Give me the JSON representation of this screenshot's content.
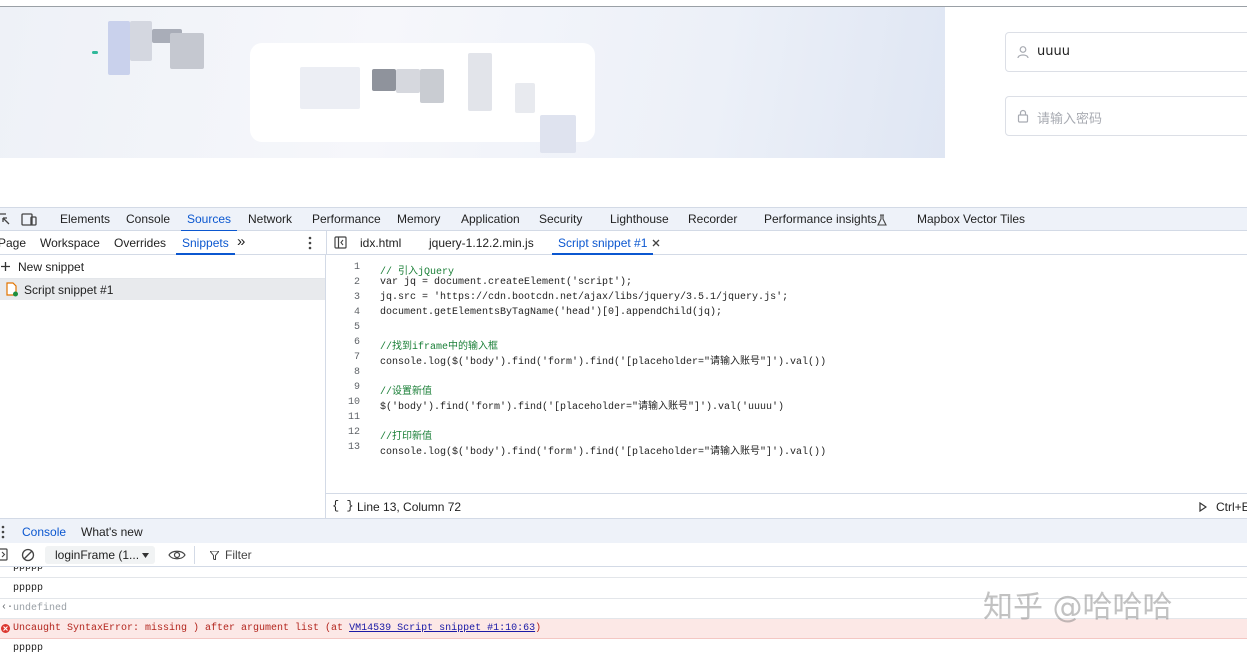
{
  "preview": {
    "username_value": "uuuu",
    "password_placeholder": "请输入密码"
  },
  "devtools": {
    "main_tabs": [
      "Elements",
      "Console",
      "Sources",
      "Network",
      "Performance",
      "Memory",
      "Application",
      "Security",
      "Lighthouse",
      "Recorder",
      "Performance insights",
      "Mapbox Vector Tiles"
    ],
    "active_main_tab": "Sources",
    "nav_tabs": [
      "Page",
      "Workspace",
      "Overrides",
      "Snippets"
    ],
    "active_nav_tab": "Snippets",
    "more_tabs_glyph": "»",
    "file_tabs": [
      "idx.html",
      "jquery-1.12.2.min.js",
      "Script snippet #1"
    ],
    "active_file_tab": "Script snippet #1",
    "new_snippet_label": "New snippet",
    "snippet_item": "Script snippet #1",
    "code_lines": [
      "// 引入jQuery",
      "var jq = document.createElement('script');",
      "jq.src = 'https://cdn.bootcdn.net/ajax/libs/jquery/3.5.1/jquery.js';",
      "document.getElementsByTagName('head')[0].appendChild(jq);",
      "",
      "//找到iframe中的输入框",
      "console.log($('body').find('form').find('[placeholder=\"请输入账号\"]').val())",
      "",
      "//设置新值",
      "$('body').find('form').find('[placeholder=\"请输入账号\"]').val('uuuu')",
      "",
      "//打印新值",
      "console.log($('body').find('form').find('[placeholder=\"请输入账号\"]').val())"
    ],
    "status_position": "Line 13, Column 72",
    "run_shortcut": "Ctrl+E",
    "drawer_tabs": [
      "Console",
      "What's new"
    ],
    "active_drawer_tab": "Console",
    "context_selector": "loginFrame (1...",
    "filter_placeholder": "Filter",
    "console_rows": {
      "row1": "ppppp",
      "row2": "ppppp",
      "row3": "undefined",
      "row4_text": "Uncaught SyntaxError: missing ) after argument list (at ",
      "row4_link": "VM14539 Script snippet #1:10:63",
      "row4_tail": ")",
      "row5": "ppppp"
    }
  },
  "watermark": "知乎 @哈哈哈",
  "colors": {
    "accent": "#0b57d0",
    "error_bg": "#fce8e6",
    "comment": "#1a7f37"
  }
}
